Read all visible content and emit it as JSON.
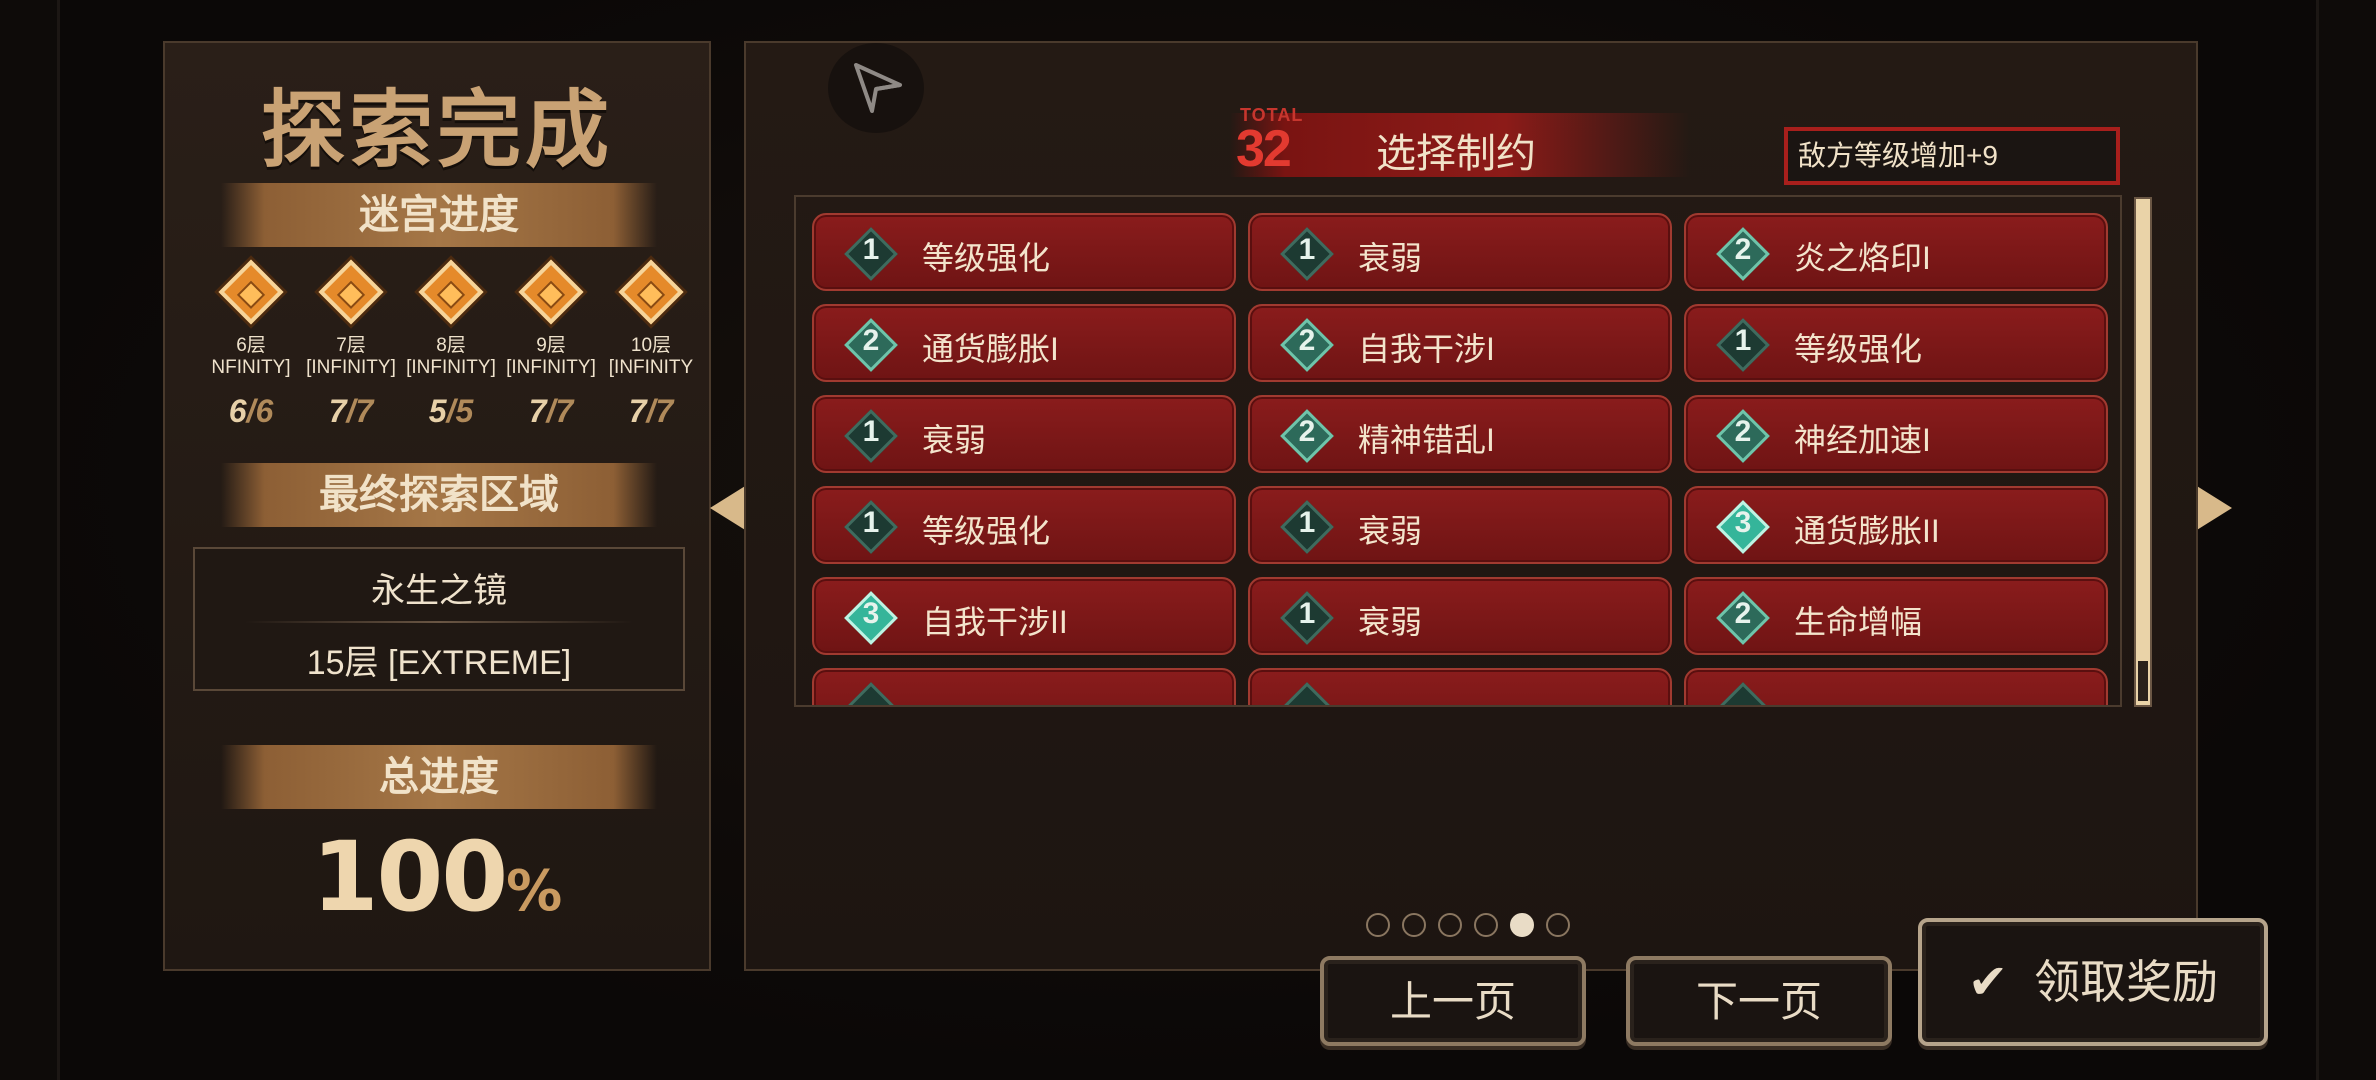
{
  "left": {
    "title": "探索完成",
    "progress_header": "迷宫进度",
    "floors": [
      {
        "name": "6层",
        "difficulty": "NFINITY]",
        "count": "6",
        "total": "6"
      },
      {
        "name": "7层",
        "difficulty": "[INFINITY]",
        "count": "7",
        "total": "7"
      },
      {
        "name": "8层",
        "difficulty": "[INFINITY]",
        "count": "5",
        "total": "5"
      },
      {
        "name": "9层",
        "difficulty": "[INFINITY]",
        "count": "7",
        "total": "7"
      },
      {
        "name": "10层",
        "difficulty": "[INFINITY",
        "count": "7",
        "total": "7"
      }
    ],
    "final_header": "最终探索区域",
    "final_name": "永生之镜",
    "final_floor": "15层 [EXTREME]",
    "total_header": "总进度",
    "total_value": "100",
    "total_unit": "%"
  },
  "main": {
    "total_label": "TOTAL",
    "total_value": "32",
    "title": "选择制约",
    "effect": "敌方等级增加+9",
    "cards": [
      {
        "level": "1",
        "label": "等级强化"
      },
      {
        "level": "1",
        "label": "衰弱"
      },
      {
        "level": "2",
        "label": "炎之烙印I"
      },
      {
        "level": "2",
        "label": "通货膨胀I"
      },
      {
        "level": "2",
        "label": "自我干涉I"
      },
      {
        "level": "1",
        "label": "等级强化"
      },
      {
        "level": "1",
        "label": "衰弱"
      },
      {
        "level": "2",
        "label": "精神错乱I"
      },
      {
        "level": "2",
        "label": "神经加速I"
      },
      {
        "level": "1",
        "label": "等级强化"
      },
      {
        "level": "1",
        "label": "衰弱"
      },
      {
        "level": "3",
        "label": "通货膨胀II"
      },
      {
        "level": "3",
        "label": "自我干涉II"
      },
      {
        "level": "1",
        "label": "衰弱"
      },
      {
        "level": "2",
        "label": "生命增幅"
      },
      {
        "level": "",
        "label": ""
      },
      {
        "level": "",
        "label": ""
      },
      {
        "level": "",
        "label": ""
      }
    ],
    "pagination": {
      "pages": 6,
      "current": 5
    }
  },
  "buttons": {
    "prev": "上一页",
    "next": "下一页",
    "claim": "领取奖励"
  },
  "colors": {
    "accent_red": "#8a1c1c",
    "gold": "#c9a274",
    "badge_teal": "#35b59a"
  }
}
